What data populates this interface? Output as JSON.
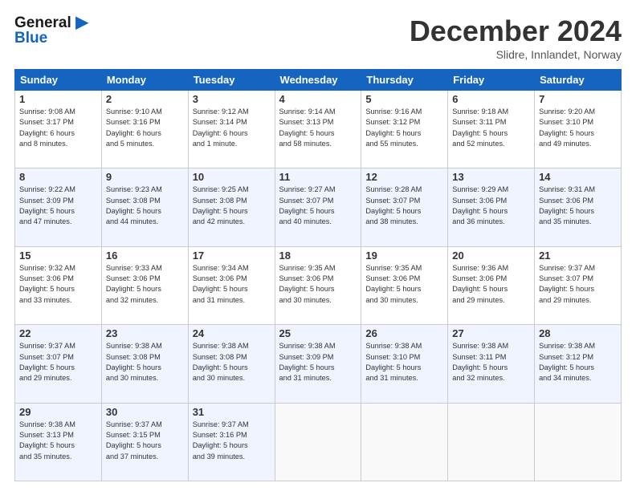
{
  "header": {
    "logo_line1": "General",
    "logo_line2": "Blue",
    "month_title": "December 2024",
    "subtitle": "Slidre, Innlandet, Norway"
  },
  "days_of_week": [
    "Sunday",
    "Monday",
    "Tuesday",
    "Wednesday",
    "Thursday",
    "Friday",
    "Saturday"
  ],
  "weeks": [
    [
      {
        "day": "1",
        "info": "Sunrise: 9:08 AM\nSunset: 3:17 PM\nDaylight: 6 hours\nand 8 minutes."
      },
      {
        "day": "2",
        "info": "Sunrise: 9:10 AM\nSunset: 3:16 PM\nDaylight: 6 hours\nand 5 minutes."
      },
      {
        "day": "3",
        "info": "Sunrise: 9:12 AM\nSunset: 3:14 PM\nDaylight: 6 hours\nand 1 minute."
      },
      {
        "day": "4",
        "info": "Sunrise: 9:14 AM\nSunset: 3:13 PM\nDaylight: 5 hours\nand 58 minutes."
      },
      {
        "day": "5",
        "info": "Sunrise: 9:16 AM\nSunset: 3:12 PM\nDaylight: 5 hours\nand 55 minutes."
      },
      {
        "day": "6",
        "info": "Sunrise: 9:18 AM\nSunset: 3:11 PM\nDaylight: 5 hours\nand 52 minutes."
      },
      {
        "day": "7",
        "info": "Sunrise: 9:20 AM\nSunset: 3:10 PM\nDaylight: 5 hours\nand 49 minutes."
      }
    ],
    [
      {
        "day": "8",
        "info": "Sunrise: 9:22 AM\nSunset: 3:09 PM\nDaylight: 5 hours\nand 47 minutes."
      },
      {
        "day": "9",
        "info": "Sunrise: 9:23 AM\nSunset: 3:08 PM\nDaylight: 5 hours\nand 44 minutes."
      },
      {
        "day": "10",
        "info": "Sunrise: 9:25 AM\nSunset: 3:08 PM\nDaylight: 5 hours\nand 42 minutes."
      },
      {
        "day": "11",
        "info": "Sunrise: 9:27 AM\nSunset: 3:07 PM\nDaylight: 5 hours\nand 40 minutes."
      },
      {
        "day": "12",
        "info": "Sunrise: 9:28 AM\nSunset: 3:07 PM\nDaylight: 5 hours\nand 38 minutes."
      },
      {
        "day": "13",
        "info": "Sunrise: 9:29 AM\nSunset: 3:06 PM\nDaylight: 5 hours\nand 36 minutes."
      },
      {
        "day": "14",
        "info": "Sunrise: 9:31 AM\nSunset: 3:06 PM\nDaylight: 5 hours\nand 35 minutes."
      }
    ],
    [
      {
        "day": "15",
        "info": "Sunrise: 9:32 AM\nSunset: 3:06 PM\nDaylight: 5 hours\nand 33 minutes."
      },
      {
        "day": "16",
        "info": "Sunrise: 9:33 AM\nSunset: 3:06 PM\nDaylight: 5 hours\nand 32 minutes."
      },
      {
        "day": "17",
        "info": "Sunrise: 9:34 AM\nSunset: 3:06 PM\nDaylight: 5 hours\nand 31 minutes."
      },
      {
        "day": "18",
        "info": "Sunrise: 9:35 AM\nSunset: 3:06 PM\nDaylight: 5 hours\nand 30 minutes."
      },
      {
        "day": "19",
        "info": "Sunrise: 9:35 AM\nSunset: 3:06 PM\nDaylight: 5 hours\nand 30 minutes."
      },
      {
        "day": "20",
        "info": "Sunrise: 9:36 AM\nSunset: 3:06 PM\nDaylight: 5 hours\nand 29 minutes."
      },
      {
        "day": "21",
        "info": "Sunrise: 9:37 AM\nSunset: 3:07 PM\nDaylight: 5 hours\nand 29 minutes."
      }
    ],
    [
      {
        "day": "22",
        "info": "Sunrise: 9:37 AM\nSunset: 3:07 PM\nDaylight: 5 hours\nand 29 minutes."
      },
      {
        "day": "23",
        "info": "Sunrise: 9:38 AM\nSunset: 3:08 PM\nDaylight: 5 hours\nand 30 minutes."
      },
      {
        "day": "24",
        "info": "Sunrise: 9:38 AM\nSunset: 3:08 PM\nDaylight: 5 hours\nand 30 minutes."
      },
      {
        "day": "25",
        "info": "Sunrise: 9:38 AM\nSunset: 3:09 PM\nDaylight: 5 hours\nand 31 minutes."
      },
      {
        "day": "26",
        "info": "Sunrise: 9:38 AM\nSunset: 3:10 PM\nDaylight: 5 hours\nand 31 minutes."
      },
      {
        "day": "27",
        "info": "Sunrise: 9:38 AM\nSunset: 3:11 PM\nDaylight: 5 hours\nand 32 minutes."
      },
      {
        "day": "28",
        "info": "Sunrise: 9:38 AM\nSunset: 3:12 PM\nDaylight: 5 hours\nand 34 minutes."
      }
    ],
    [
      {
        "day": "29",
        "info": "Sunrise: 9:38 AM\nSunset: 3:13 PM\nDaylight: 5 hours\nand 35 minutes."
      },
      {
        "day": "30",
        "info": "Sunrise: 9:37 AM\nSunset: 3:15 PM\nDaylight: 5 hours\nand 37 minutes."
      },
      {
        "day": "31",
        "info": "Sunrise: 9:37 AM\nSunset: 3:16 PM\nDaylight: 5 hours\nand 39 minutes."
      },
      {
        "day": "",
        "info": ""
      },
      {
        "day": "",
        "info": ""
      },
      {
        "day": "",
        "info": ""
      },
      {
        "day": "",
        "info": ""
      }
    ]
  ]
}
